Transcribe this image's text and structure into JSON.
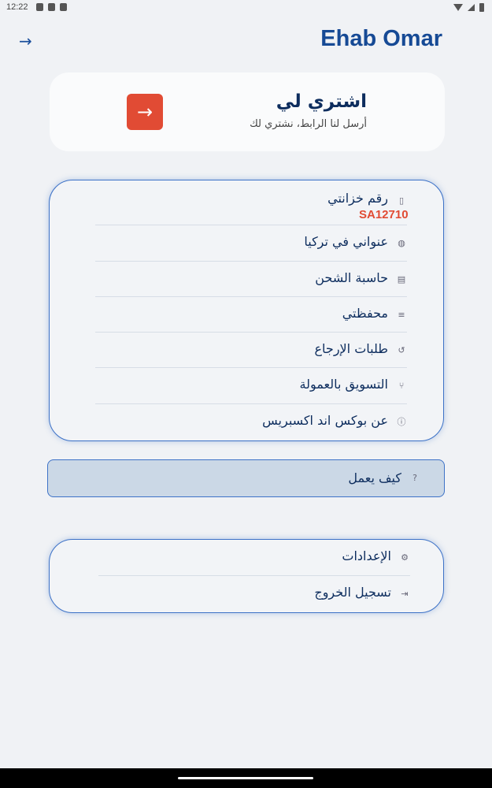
{
  "status": {
    "time": "12:22"
  },
  "header": {
    "user_name": "Ehab Omar",
    "back_icon": "arrow-right-icon"
  },
  "buy_for_me": {
    "title": "اشتري لي",
    "subtitle": "أرسل لنا الرابط، نشتري لك",
    "button_icon": "arrow-right-icon",
    "accent": "#e14b34"
  },
  "menu": {
    "locker_number": {
      "label": "رقم خزانتي",
      "value": "SA12710",
      "icon": "locker-icon"
    },
    "items": [
      {
        "label": "عنواني في تركيا",
        "icon": "globe-icon"
      },
      {
        "label": "حاسبة الشحن",
        "icon": "calculator-icon"
      },
      {
        "label": "محفظتي",
        "icon": "wallet-icon"
      },
      {
        "label": "طلبات الإرجاع",
        "icon": "history-icon"
      },
      {
        "label": "التسويق بالعمولة",
        "icon": "affiliate-icon"
      },
      {
        "label": "عن بوكس اند اكسبريس",
        "icon": "info-icon"
      }
    ]
  },
  "how_it_works": {
    "label": "كيف يعمل",
    "icon": "help-icon"
  },
  "account": {
    "items": [
      {
        "label": "الإعدادات",
        "icon": "gear-icon"
      },
      {
        "label": "تسجيل الخروج",
        "icon": "logout-icon"
      }
    ]
  },
  "colors": {
    "primary": "#164a95",
    "border": "#3d72c7",
    "background": "#f0f2f5",
    "accent": "#e14b34"
  }
}
